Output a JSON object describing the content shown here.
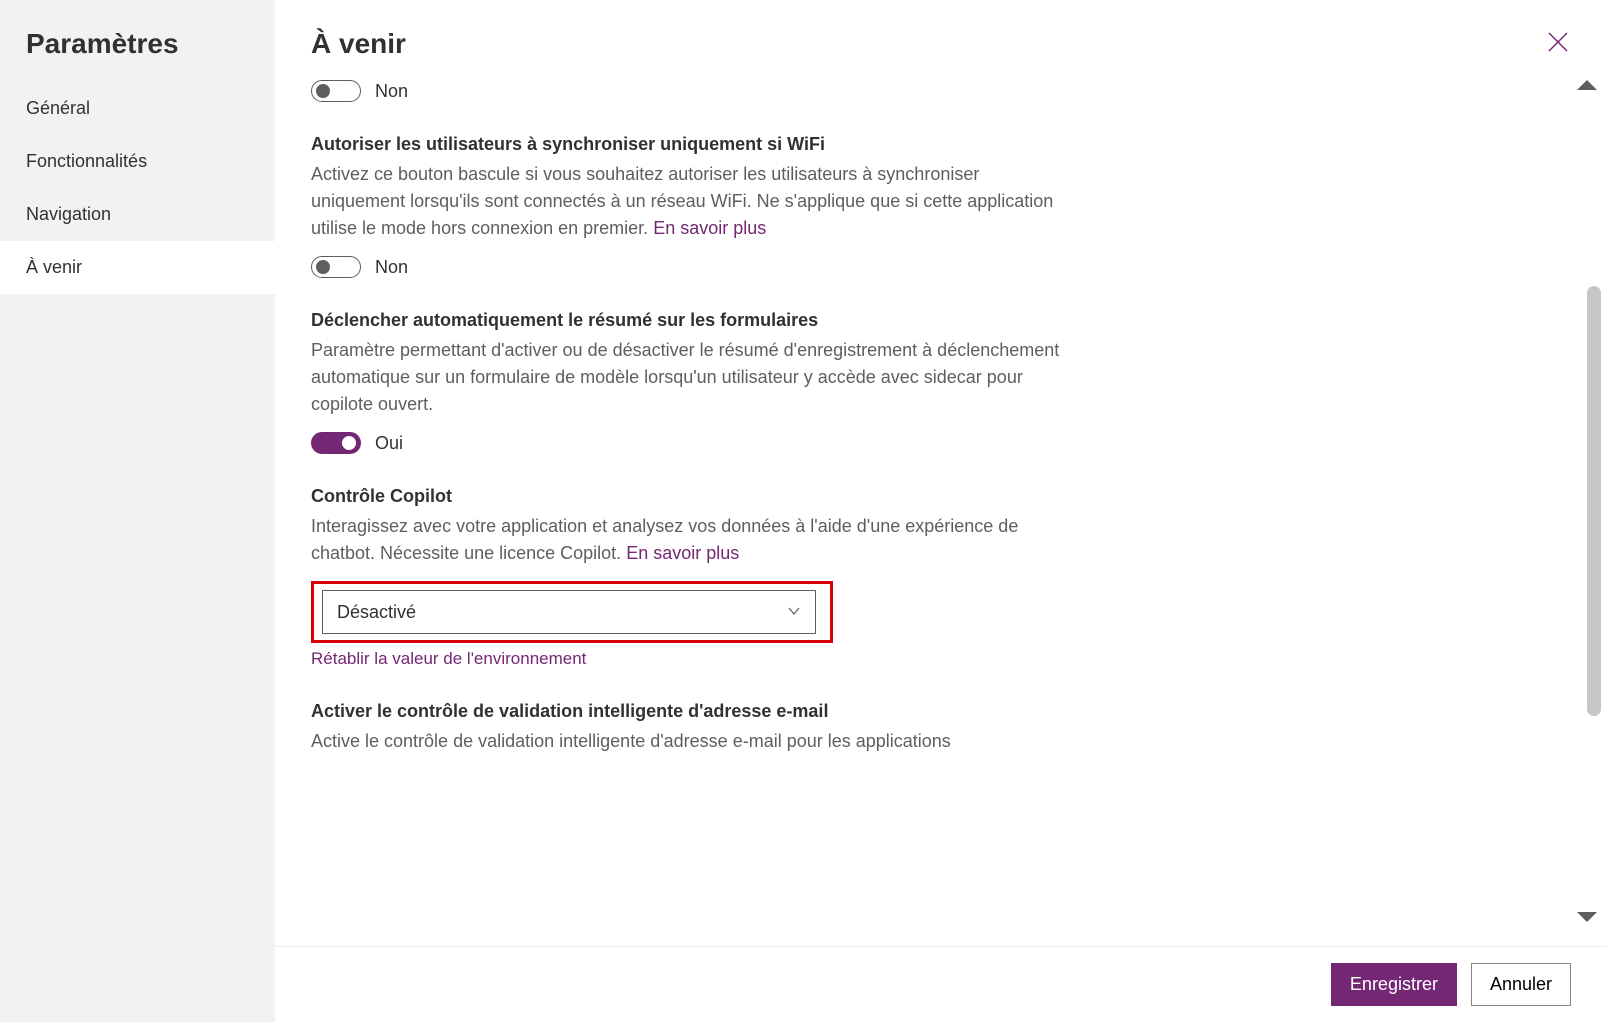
{
  "sidebar": {
    "title": "Paramètres",
    "items": [
      {
        "label": "Général"
      },
      {
        "label": "Fonctionnalités"
      },
      {
        "label": "Navigation"
      },
      {
        "label": "À venir"
      }
    ]
  },
  "page": {
    "title": "À venir"
  },
  "settings": {
    "toggle0": {
      "value_label": "Non"
    },
    "wifi_sync": {
      "title": "Autoriser les utilisateurs à synchroniser uniquement si WiFi",
      "desc": "Activez ce bouton bascule si vous souhaitez autoriser les utilisateurs à synchroniser uniquement lorsqu'ils sont connectés à un réseau WiFi. Ne s'applique que si cette application utilise le mode hors connexion en premier. ",
      "learn_more": "En savoir plus",
      "value_label": "Non"
    },
    "auto_summary": {
      "title": "Déclencher automatiquement le résumé sur les formulaires",
      "desc": "Paramètre permettant d'activer ou de désactiver le résumé d'enregistrement à déclenchement automatique sur un formulaire de modèle lorsqu'un utilisateur y accède avec sidecar pour copilote ouvert.",
      "value_label": "Oui"
    },
    "copilot_control": {
      "title": "Contrôle Copilot",
      "desc": "Interagissez avec votre application et analysez vos données à l'aide d'une expérience de chatbot. Nécessite une licence Copilot. ",
      "learn_more": "En savoir plus",
      "selected": "Désactivé",
      "restore": "Rétablir la valeur de l'environnement"
    },
    "email_validation": {
      "title": "Activer le contrôle de validation intelligente d'adresse e-mail",
      "desc": "Active le contrôle de validation intelligente d'adresse e-mail pour les applications"
    }
  },
  "footer": {
    "save": "Enregistrer",
    "cancel": "Annuler"
  }
}
